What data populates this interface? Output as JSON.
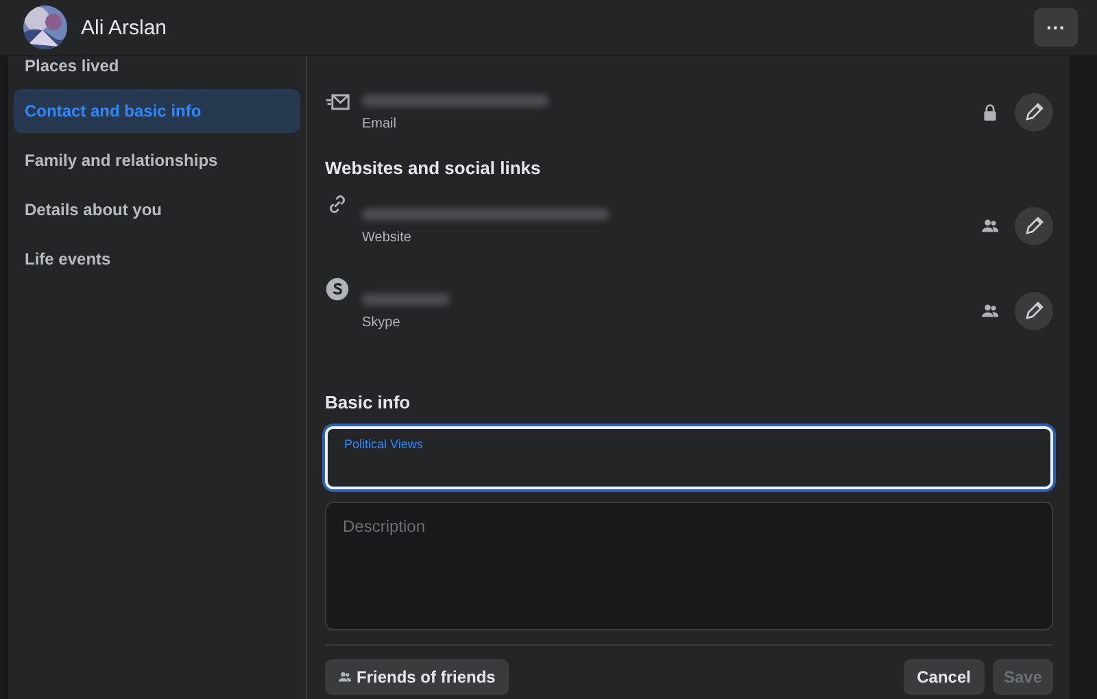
{
  "header": {
    "name": "Ali Arslan",
    "more_button": "···"
  },
  "sidebar": {
    "items": [
      {
        "label": "Places lived",
        "selected": false
      },
      {
        "label": "Contact and basic info",
        "selected": true
      },
      {
        "label": "Family and relationships",
        "selected": false
      },
      {
        "label": "Details about you",
        "selected": false
      },
      {
        "label": "Life events",
        "selected": false
      }
    ]
  },
  "contact": [
    {
      "kind": "email",
      "label": "Email",
      "privacy": {
        "kind": "lock"
      }
    }
  ],
  "websites": {
    "title": "Websites and social links",
    "items": [
      {
        "kind": "link",
        "label": "Website",
        "privacy": {
          "kind": "friends"
        }
      },
      {
        "kind": "skype",
        "label": "Skype",
        "privacy": {
          "kind": "friends"
        }
      }
    ]
  },
  "basic_info": {
    "title": "Basic info",
    "political_views": {
      "label": "Political Views",
      "focused": true
    },
    "description": {
      "placeholder": "Description"
    },
    "audience_button": "Friends of friends",
    "cancel_button": "Cancel",
    "save_button": {
      "label": "Save",
      "disabled": true
    }
  }
}
